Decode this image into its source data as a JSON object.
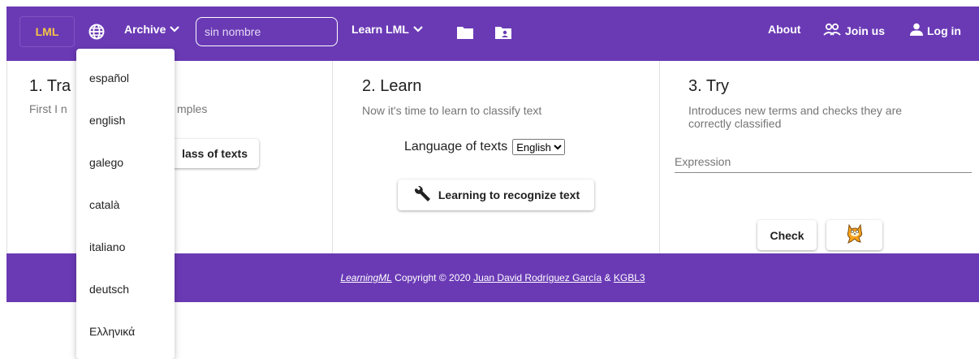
{
  "header": {
    "brand": "LML",
    "archive_label": "Archive",
    "search_placeholder": "sin nombre",
    "learn_label": "Learn LML",
    "about_label": "About",
    "join_label": "Join us",
    "login_label": "Log in"
  },
  "language_menu": {
    "items": [
      "español",
      "english",
      "galego",
      "català",
      "italiano",
      "deutsch",
      "Ελληνικά"
    ]
  },
  "cards": [
    {
      "title": "1. Tra",
      "subtitle_left": "First I n",
      "subtitle_right": "mples",
      "button_label": "lass of texts"
    },
    {
      "title": "2. Learn",
      "subtitle": "Now it's time to learn to classify text",
      "language_label": "Language of texts",
      "language_selected": "English",
      "button_label": "Learning to recognize text"
    },
    {
      "title": "3. Try",
      "subtitle_line1": "Introduces new terms and checks they are",
      "subtitle_line2": "correctly classified",
      "expression_placeholder": "Expression",
      "check_label": "Check"
    }
  ],
  "footer": {
    "app_name": "LearningML",
    "copyright": "Copyright © 2020",
    "author": "Juan David Rodríguez García",
    "amp": "&",
    "org": "KGBL3"
  },
  "colors": {
    "appbar": "#6a3ab5",
    "brand": "#f6c445"
  },
  "icons": {
    "language": "globe-icon",
    "archive_chevron": "chevron-down-icon",
    "learn_chevron": "chevron-down-icon",
    "folder": "folder-icon",
    "shared_folder": "folder-account-icon",
    "join": "people-icon",
    "login": "person-icon",
    "learn_button": "wrench-icon",
    "scratch": "scratch-cat-icon"
  }
}
